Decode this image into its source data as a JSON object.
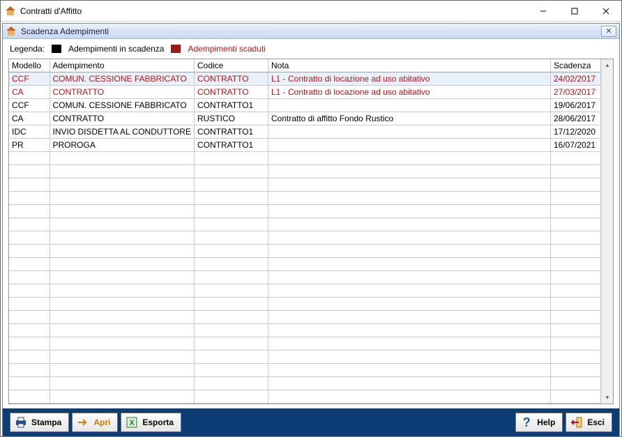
{
  "window": {
    "title": "Contratti d'Affitto"
  },
  "panel": {
    "title": "Scadenza Adempimenti"
  },
  "legend": {
    "label": "Legenda:",
    "in_scadenza": "Adempimenti in scadenza",
    "scaduti": "Adempimenti scaduti"
  },
  "columns": {
    "modello": "Modello",
    "adempimento": "Adempimento",
    "codice": "Codice",
    "nota": "Nota",
    "scadenza": "Scadenza"
  },
  "rows": [
    {
      "modello": "CCF",
      "adempimento": "COMUN. CESSIONE FABBRICATO",
      "codice": "CONTRATTO",
      "nota": "L1 - Contratto di locazione ad uso abitativo",
      "scadenza": "24/02/2017",
      "overdue": true,
      "selected": true
    },
    {
      "modello": "CA",
      "adempimento": "CONTRATTO",
      "codice": "CONTRATTO",
      "nota": "L1 - Contratto di locazione ad uso abitativo",
      "scadenza": "27/03/2017",
      "overdue": true
    },
    {
      "modello": "CCF",
      "adempimento": "COMUN. CESSIONE FABBRICATO",
      "codice": "CONTRATTO1",
      "nota": "",
      "scadenza": "19/06/2017"
    },
    {
      "modello": "CA",
      "adempimento": "CONTRATTO",
      "codice": "RUSTICO",
      "nota": "Contratto di affitto Fondo Rustico",
      "scadenza": "28/06/2017"
    },
    {
      "modello": "IDC",
      "adempimento": "INVIO DISDETTA AL CONDUTTORE",
      "codice": "CONTRATTO1",
      "nota": "",
      "scadenza": "17/12/2020"
    },
    {
      "modello": "PR",
      "adempimento": "PROROGA",
      "codice": "CONTRATTO1",
      "nota": "",
      "scadenza": "16/07/2021"
    }
  ],
  "empty_row_count": 19,
  "buttons": {
    "stampa": "Stampa",
    "apri": "Apri",
    "esporta": "Esporta",
    "help": "Help",
    "esci": "Esci"
  }
}
